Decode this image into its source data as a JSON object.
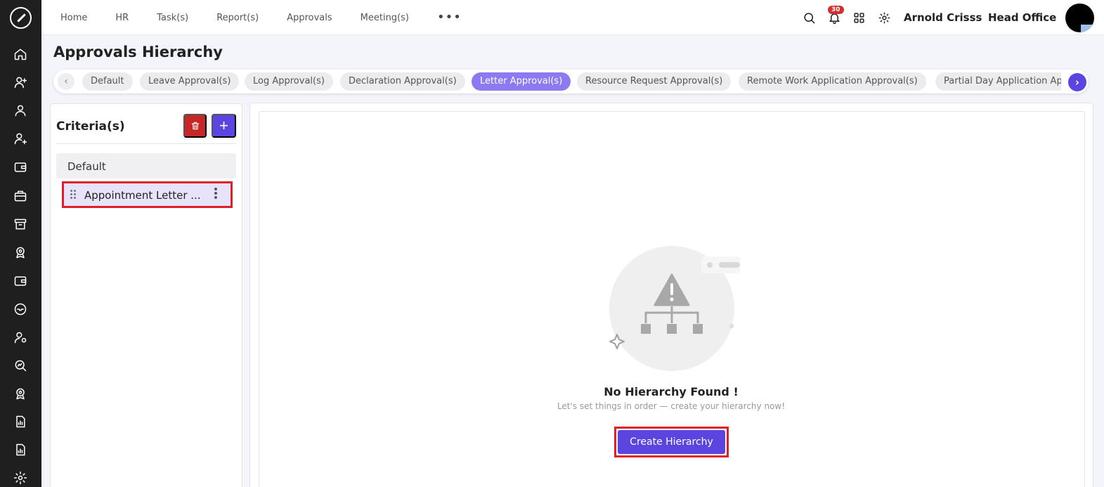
{
  "topnav": {
    "items": [
      "Home",
      "HR",
      "Task(s)",
      "Report(s)",
      "Approvals",
      "Meeting(s)"
    ],
    "more_label": "•••",
    "notification_count": "30",
    "user_name": "Arnold Crisss",
    "office": "Head Office"
  },
  "page": {
    "title": "Approvals Hierarchy"
  },
  "tabs": {
    "items": [
      "Default",
      "Leave Approval(s)",
      "Log Approval(s)",
      "Declaration Approval(s)",
      "Letter Approval(s)",
      "Resource Request Approval(s)",
      "Remote Work Application Approval(s)",
      "Partial Day Application Approval(s)"
    ],
    "active_index": 4,
    "prev_icon": "‹",
    "next_icon": "›"
  },
  "criteria": {
    "title": "Criteria(s)",
    "add_icon": "+",
    "items": [
      "Default",
      "Appointment Letter ..."
    ],
    "selected_index": 1
  },
  "empty_state": {
    "title": "No Hierarchy Found !",
    "subtitle": "Let's set things in order — create your hierarchy now!",
    "create_button": "Create Hierarchy"
  },
  "colors": {
    "accent": "#5b45e0",
    "active_tab": "#8e7af0",
    "danger": "#c62828",
    "highlight_border": "#e02028",
    "rail": "#1f1f1f"
  },
  "icons": {
    "rail": [
      "home-icon",
      "user-add-icon",
      "user-icon",
      "user-plus-icon",
      "wallet-icon",
      "briefcase-icon",
      "archive-icon",
      "award-icon",
      "wallet-2-icon",
      "inbox-icon",
      "user-settings-icon",
      "search-chart-icon",
      "rosette-icon",
      "file-chart-icon",
      "file-chart-2-icon",
      "settings-icon"
    ],
    "top": [
      "search-icon",
      "bell-icon",
      "apps-grid-icon",
      "gear-icon"
    ]
  }
}
